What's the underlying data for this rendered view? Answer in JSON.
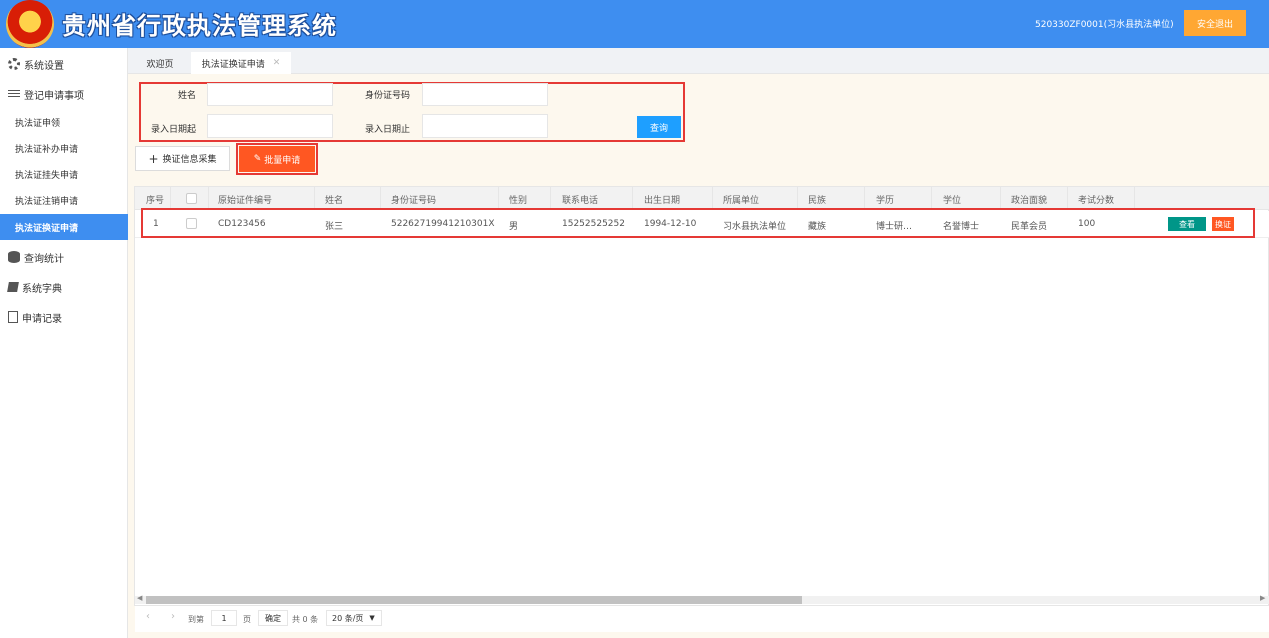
{
  "header": {
    "title": "贵州省行政执法管理系统",
    "user": "520330ZF0001(习水县执法单位)",
    "logout_label": "安全退出"
  },
  "sidebar": {
    "items": [
      {
        "label": "系统设置",
        "icon": "gear-icon"
      },
      {
        "label": "登记申请事项",
        "icon": "filter-icon"
      },
      {
        "label": "查询统计",
        "icon": "database-icon"
      },
      {
        "label": "系统字典",
        "icon": "book-icon"
      },
      {
        "label": "申请记录",
        "icon": "document-icon"
      }
    ],
    "sub_items": [
      "执法证申领",
      "执法证补办申请",
      "执法证挂失申请",
      "执法证注销申请",
      "执法证换证申请"
    ]
  },
  "tabs": [
    {
      "label": "欢迎页"
    },
    {
      "label": "执法证换证申请"
    }
  ],
  "search": {
    "name_label": "姓名",
    "id_label": "身份证号码",
    "date_start_label": "录入日期起",
    "date_end_label": "录入日期止",
    "query_label": "查询"
  },
  "toolbar": {
    "collect_label": "换证信息采集",
    "batch_label": "批量申请"
  },
  "table": {
    "headers": [
      "序号",
      "原始证件编号",
      "姓名",
      "身份证号码",
      "性别",
      "联系电话",
      "出生日期",
      "所属单位",
      "民族",
      "学历",
      "学位",
      "政治面貌",
      "考试分数"
    ],
    "rows": [
      [
        "1",
        "CD123456",
        "张三",
        "52262719941210301X",
        "男",
        "15252525252",
        "1994-12-10",
        "习水县执法单位",
        "藏族",
        "博士研…",
        "名誉博士",
        "民革会员",
        "100"
      ]
    ],
    "view_label": "查看",
    "renew_label": "换证"
  },
  "pager": {
    "goto_label": "到第",
    "page_value": "1",
    "page_unit": "页",
    "confirm_label": "确定",
    "total": "共 0 条",
    "page_size": "20 条/页"
  },
  "colors": {
    "header_bg": "#3e8ef0",
    "logout_bg": "#ffa733",
    "query_bg": "#1e9fff",
    "batch_bg": "#ff5722",
    "view_bg": "#009688",
    "highlight": "#e53935"
  }
}
